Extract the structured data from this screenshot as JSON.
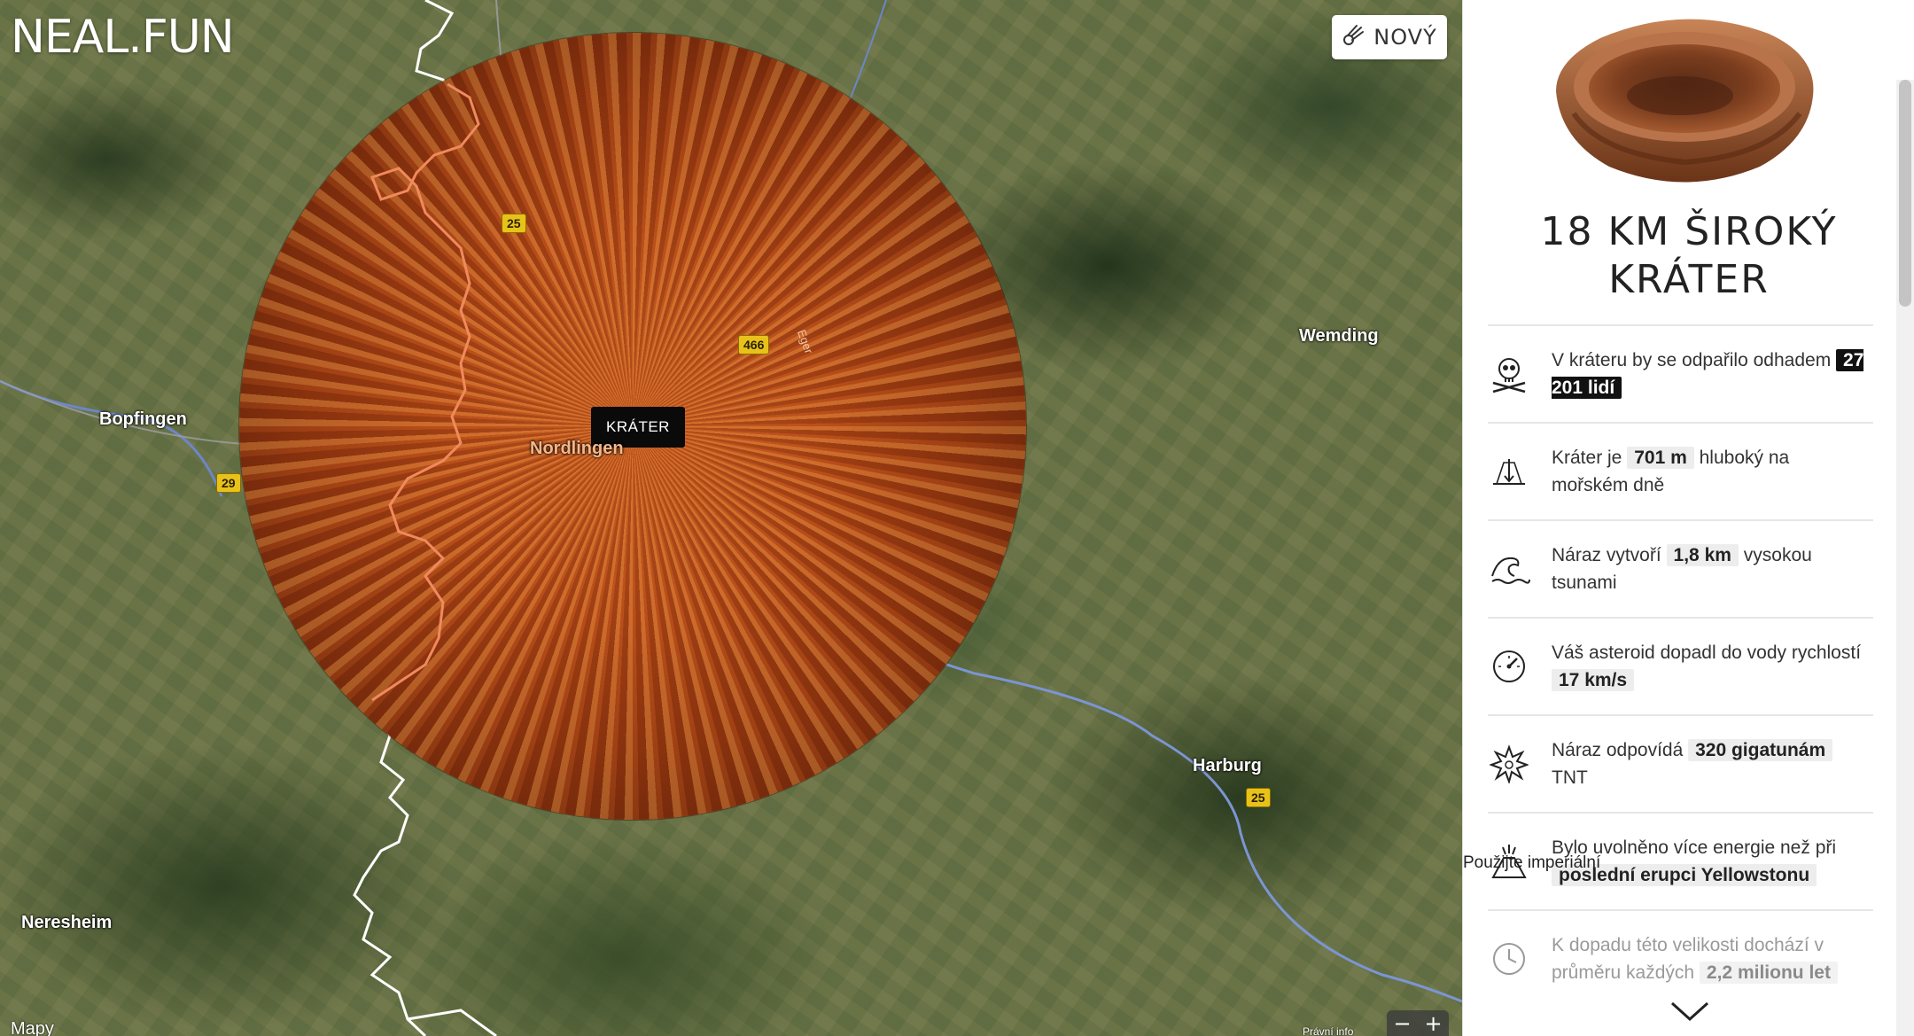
{
  "header": {
    "logo": "NEAL.FUN",
    "new_button": "NOVÝ",
    "new_icon": "comet-icon"
  },
  "map": {
    "crater_label": "KRÁTER",
    "cities": [
      "Bopfingen",
      "Nordlingen",
      "Wemding",
      "Harburg",
      "Neresheim"
    ],
    "roads": [
      "25",
      "466",
      "29",
      "25"
    ],
    "river_label": "Eger",
    "credit": "Mapy",
    "legal": "Právní info",
    "zoom_out": "−",
    "zoom_in": "+",
    "imperial_toggle": "Použijte imperiální"
  },
  "panel": {
    "title_line1": "18 KM ŠIROKÝ",
    "title_line2": "KRÁTER",
    "facts": [
      {
        "icon": "skull-icon",
        "pre": "V kráteru by se odpařilo odhadem",
        "value": "27 201 lidí",
        "post": ""
      },
      {
        "icon": "depth-icon",
        "pre": "Kráter je",
        "value": "701 m",
        "post": "hluboký na mořském dně"
      },
      {
        "icon": "wave-icon",
        "pre": "Náraz vytvoří",
        "value": "1,8 km",
        "post": "vysokou tsunami"
      },
      {
        "icon": "speedometer-icon",
        "pre": "Váš asteroid dopadl do vody rychlostí",
        "value": "17 km/s",
        "post": ""
      },
      {
        "icon": "explosion-icon",
        "pre": "Náraz odpovídá",
        "value": "320 gigatunám",
        "post": "TNT"
      },
      {
        "icon": "volcano-icon",
        "pre": "Bylo uvolněno více energie než při",
        "value": "poslední erupci Yellowstonu",
        "post": ""
      },
      {
        "icon": "clock-icon",
        "pre": "K dopadu této velikosti dochází v průměru každých",
        "value": "2,2 milionu let",
        "post": ""
      }
    ],
    "scroll_icon": "chevron-down-icon"
  },
  "colors": {
    "crater_core": "#c35a21",
    "crater_edge": "#3d1406",
    "road_badge": "#e8c21a",
    "border_line": "#f08a5d"
  }
}
